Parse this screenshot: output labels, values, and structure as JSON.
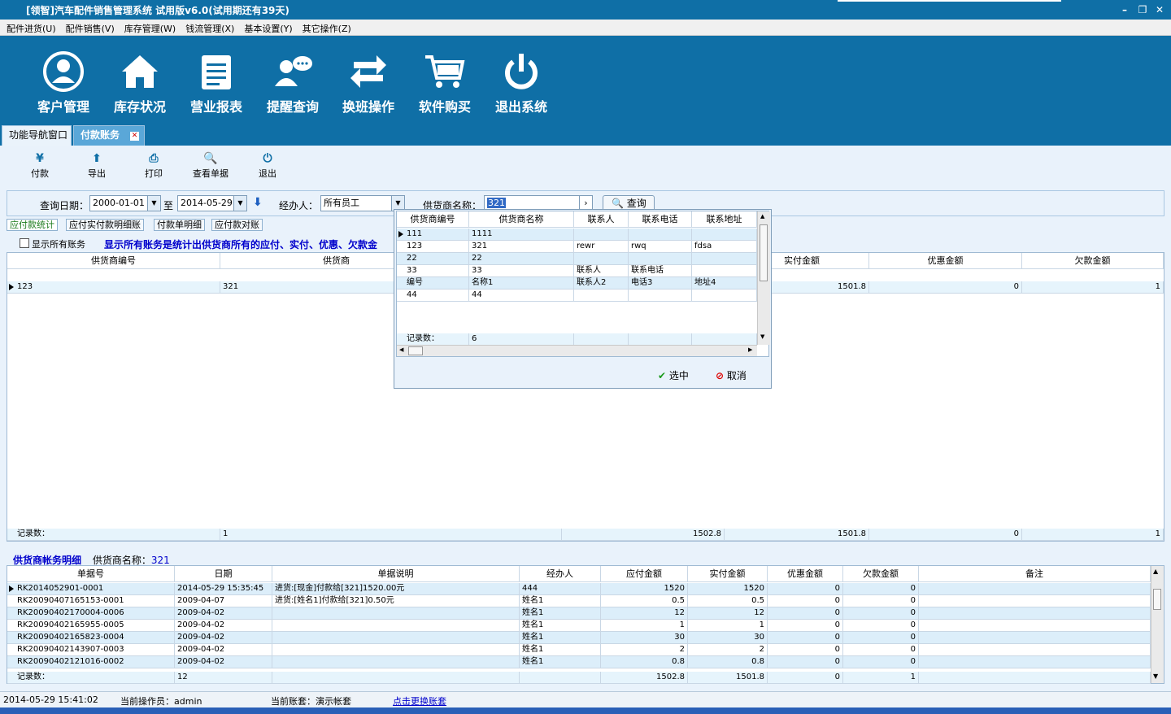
{
  "window": {
    "title": "[领智]汽车配件销售管理系统  试用版v6.0(试用期还有39天)"
  },
  "menu": [
    "配件进货(U)",
    "配件销售(V)",
    "库存管理(W)",
    "钱流管理(X)",
    "基本设置(Y)",
    "其它操作(Z)"
  ],
  "toolbar": [
    {
      "label": "客户管理",
      "icon": "user-icon"
    },
    {
      "label": "库存状况",
      "icon": "home-icon"
    },
    {
      "label": "营业报表",
      "icon": "report-icon"
    },
    {
      "label": "提醒查询",
      "icon": "chat-icon"
    },
    {
      "label": "换班操作",
      "icon": "swap-icon"
    },
    {
      "label": "软件购买",
      "icon": "cart-icon"
    },
    {
      "label": "退出系统",
      "icon": "power-icon"
    }
  ],
  "tabs": [
    "功能导航窗口",
    "付款账务"
  ],
  "subtoolbar": [
    {
      "label": "付款",
      "icon": "yen-icon"
    },
    {
      "label": "导出",
      "icon": "export-icon"
    },
    {
      "label": "打印",
      "icon": "print-icon"
    },
    {
      "label": "查看单据",
      "icon": "view-doc-icon"
    },
    {
      "label": "退出",
      "icon": "exit-icon"
    }
  ],
  "query": {
    "date_label": "查询日期：",
    "date_from": "2000-01-01",
    "to_label": "至",
    "date_to": "2014-05-29",
    "handler_label": "经办人：",
    "handler_value": "所有员工",
    "supplier_label": "供货商名称：",
    "supplier_value": "321",
    "search_label": "查询"
  },
  "subtabs": [
    "应付款统计",
    "应付实付款明细账",
    "付款单明细",
    "应付款对账"
  ],
  "show_all_label": "显示所有账务",
  "notice": "显示所有账务是统计出供货商所有的应付、实付、优惠、欠款金",
  "summary_grid": {
    "headers": [
      "供货商编号",
      "供货商",
      "实付金额",
      "优惠金额",
      "欠款金额"
    ],
    "row": {
      "code": "123",
      "name": "321",
      "paid": "1501.8",
      "discount": "0",
      "owed": "1"
    },
    "footer": {
      "label": "记录数：",
      "count": "1",
      "payable": "1502.8",
      "paid": "1501.8",
      "discount": "0",
      "owed": "1"
    }
  },
  "popup": {
    "headers": [
      "供货商编号",
      "供货商名称",
      "联系人",
      "联系电话",
      "联系地址"
    ],
    "rows": [
      [
        "111",
        "1111",
        "",
        "",
        ""
      ],
      [
        "123",
        "321",
        "rewr",
        "rwq",
        "fdsa"
      ],
      [
        "22",
        "22",
        "",
        "",
        ""
      ],
      [
        "33",
        "33",
        "联系人",
        "联系电话",
        ""
      ],
      [
        "编号",
        "名称1",
        "联系人2",
        "电话3",
        "地址4"
      ],
      [
        "44",
        "44",
        "",
        "",
        ""
      ]
    ],
    "footer_label": "记录数：",
    "footer_count": "6",
    "select_label": "选中",
    "cancel_label": "取消"
  },
  "detail": {
    "title": "供货商帐务明细",
    "supplier_label": "供货商名称：",
    "supplier_value": "321",
    "headers": [
      "单据号",
      "日期",
      "单据说明",
      "经办人",
      "应付金额",
      "实付金额",
      "优惠金额",
      "欠款金额",
      "备注"
    ],
    "rows": [
      [
        "RK2014052901-0001",
        "2014-05-29 15:35:45",
        "进货:[现金]付款给[321]1520.00元",
        "444",
        "1520",
        "1520",
        "0",
        "0",
        ""
      ],
      [
        "RK20090407165153-0001",
        "2009-04-07",
        "进货:[姓名1]付款给[321]0.50元",
        "姓名1",
        "0.5",
        "0.5",
        "0",
        "0",
        ""
      ],
      [
        "RK20090402170004-0006",
        "2009-04-02",
        "",
        "姓名1",
        "12",
        "12",
        "0",
        "0",
        ""
      ],
      [
        "RK20090402165955-0005",
        "2009-04-02",
        "",
        "姓名1",
        "1",
        "1",
        "0",
        "0",
        ""
      ],
      [
        "RK20090402165823-0004",
        "2009-04-02",
        "",
        "姓名1",
        "30",
        "30",
        "0",
        "0",
        ""
      ],
      [
        "RK20090402143907-0003",
        "2009-04-02",
        "",
        "姓名1",
        "2",
        "2",
        "0",
        "0",
        ""
      ],
      [
        "RK20090402121016-0002",
        "2009-04-02",
        "",
        "姓名1",
        "0.8",
        "0.8",
        "0",
        "0",
        ""
      ]
    ],
    "footer": {
      "label": "记录数：",
      "count": "12",
      "payable": "1502.8",
      "paid": "1501.8",
      "discount": "0",
      "owed": "1"
    }
  },
  "status": {
    "datetime": "2014-05-29 15:41:02",
    "operator": "当前操作员：admin",
    "account": "当前账套：演示帐套",
    "switch_link": "点击更换账套"
  },
  "colors": {
    "brand": "#0f6fa6",
    "panel": "#e9f2fb",
    "row_alt": "#dceefa",
    "notice": "#0000cc"
  }
}
